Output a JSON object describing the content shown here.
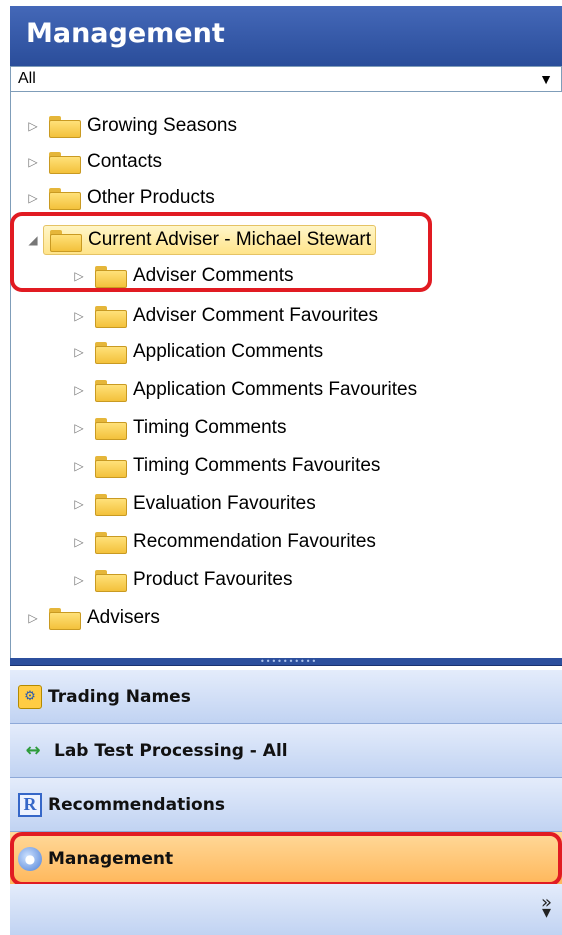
{
  "header": {
    "title": "Management"
  },
  "filter": {
    "value": "All"
  },
  "tree": [
    {
      "label": "Growing Seasons"
    },
    {
      "label": "Contacts"
    },
    {
      "label": "Other Products"
    },
    {
      "label": "Current Adviser - Michael Stewart",
      "expanded": true,
      "selected": true
    },
    {
      "label": "Adviser Comments"
    },
    {
      "label": "Adviser Comment Favourites"
    },
    {
      "label": "Application Comments"
    },
    {
      "label": "Application Comments Favourites"
    },
    {
      "label": "Timing Comments"
    },
    {
      "label": "Timing Comments Favourites"
    },
    {
      "label": "Evaluation Favourites"
    },
    {
      "label": "Recommendation Favourites"
    },
    {
      "label": "Product Favourites"
    },
    {
      "label": "Advisers"
    }
  ],
  "nav": {
    "trading_names": "Trading Names",
    "lab_test": "Lab Test Processing - All",
    "recommendations": "Recommendations",
    "management": "Management"
  },
  "colors": {
    "header": "#2f56a4",
    "active_nav": "#ffc271",
    "highlight": "#e11b22"
  }
}
